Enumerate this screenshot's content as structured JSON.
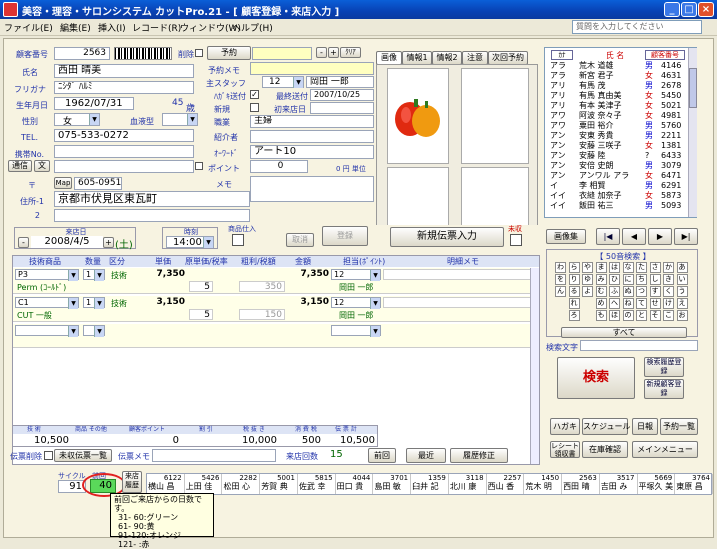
{
  "window": {
    "title": "美容・理容・サロンシステム カットPro.21 - [ 顧客登録・来店入力 ]"
  },
  "menu": [
    "ファイル(E)",
    "編集(E)",
    "挿入(I)",
    "レコード(R)",
    "ウィンドウ(W)",
    "ヘルプ(H)"
  ],
  "help_placeholder": "質問を入力してください",
  "customer": {
    "id_label": "顧客番号",
    "id": "2563",
    "delete_label": "削除",
    "reserve_btn": "予約",
    "clear_btn": "ｸﾘｱ",
    "name_label": "氏名",
    "name": "西田 晴美",
    "furigana_label": "フリガナ",
    "furigana": "ﾆｼﾀﾞ ﾊﾙﾐ",
    "dob_label": "生年月日",
    "dob": "1962/07/31",
    "age": "45",
    "age_unit": "歳",
    "sex_label": "性別",
    "sex": "女",
    "blood_label": "血液型",
    "tel_label": "TEL.",
    "tel": "075-533-0272",
    "mobile_label": "携帯No.",
    "mail_btn": "通信",
    "text_btn": "文",
    "zip_label": "〒",
    "map_btn": "Map",
    "zip": "605-0951",
    "addr1_label": "住所-1",
    "addr1": "京都市伏見区東瓦町",
    "addr2_label": "2",
    "memo_label": "予約メモ",
    "staff_label": "主スタッフ",
    "staff_no": "12",
    "staff_name": "岡田 一郎",
    "dm_label": "ﾊｶﾞｷ送付",
    "last_sent_label": "最終送付",
    "last_sent": "2007/10/25",
    "new_label": "新規",
    "first_staff_label": "初来店日",
    "job_label": "職業",
    "job": "主婦",
    "intro_label": "紹介者",
    "keyword_label": "ｵｰﾜｰﾄﾞ",
    "keyword": "アート10",
    "point_label": "ポイント",
    "point": "0",
    "point_unit": "0 円 単位",
    "memo2_label": "メモ"
  },
  "photo_tabs": [
    "画像",
    "情報1",
    "情報2",
    "注意",
    "次回予約"
  ],
  "clist": {
    "h_kana": "ｶﾅ",
    "h_name": "氏 名",
    "h_num": "顧客番号",
    "rows": [
      [
        "アラ",
        "荒木 道雄",
        "男",
        "4146"
      ],
      [
        "アラ",
        "新宮 君子",
        "女",
        "4631"
      ],
      [
        "アリ",
        "有馬 茂",
        "男",
        "2678"
      ],
      [
        "アリ",
        "有馬 真由美",
        "女",
        "5450"
      ],
      [
        "アリ",
        "有本 美津子",
        "女",
        "5021"
      ],
      [
        "アワ",
        "阿波 奈々子",
        "女",
        "4981"
      ],
      [
        "アワ",
        "粟田 裕介",
        "男",
        "5760"
      ],
      [
        "アン",
        "安東 秀貴",
        "男",
        "2211"
      ],
      [
        "アン",
        "安藤 三咲子",
        "女",
        "1381"
      ],
      [
        "アン",
        "安藤 陸",
        "?",
        "6433"
      ],
      [
        "アン",
        "安倍 史朗",
        "男",
        "3079"
      ],
      [
        "アン",
        "アンワル アラ",
        "女",
        "6471"
      ],
      [
        "イ",
        "李 相賢",
        "男",
        "6291"
      ],
      [
        "イイ",
        "衣縫 加奈子",
        "女",
        "5873"
      ],
      [
        "イイ",
        "飯田 祐三",
        "男",
        "5093"
      ]
    ],
    "image_btn": "画像集"
  },
  "kana_title": "【 50音検索 】",
  "kana_rows": [
    [
      "わ",
      "ら",
      "や",
      "ま",
      "は",
      "な",
      "た",
      "さ",
      "か",
      "あ"
    ],
    [
      "を",
      "り",
      "ゆ",
      "み",
      "ひ",
      "に",
      "ち",
      "し",
      "き",
      "い"
    ],
    [
      "ん",
      "る",
      "よ",
      "む",
      "ふ",
      "ぬ",
      "つ",
      "す",
      "く",
      "う"
    ],
    [
      "",
      "れ",
      "",
      "め",
      "へ",
      "ね",
      "て",
      "せ",
      "け",
      "え"
    ],
    [
      "",
      "ろ",
      "",
      "も",
      "ほ",
      "の",
      "と",
      "そ",
      "こ",
      "お"
    ]
  ],
  "kana_all": "すべて",
  "search": {
    "label": "検索文字",
    "btn": "検索",
    "hist_btn": "検索履歴登録",
    "new_btn": "新規顧客登録"
  },
  "side_btns": [
    "ハガキ",
    "スケジュール",
    "日報",
    "予約一覧",
    "レシート領収書",
    "在庫確認",
    "メインメニュー"
  ],
  "visit": {
    "date_label": "来店日",
    "date": "2008/4/5",
    "weekday": "(土)",
    "time_label": "時刻",
    "time": "14:00",
    "goods_label": "商品仕入",
    "cancel_btn": "取消",
    "register_btn": "登録",
    "new_slip_btn": "新規伝票入力",
    "unpaid_label": "未収"
  },
  "slip": {
    "headers": [
      "技術商品",
      "数量",
      "区分",
      "単価",
      "原単価/税率",
      "粗利/税額",
      "金額",
      "担当(ﾎﾟｲﾝﾄ)",
      "明細メモ"
    ],
    "rows": [
      {
        "code": "P3",
        "qty": "1",
        "kind": "技術",
        "price": "7,350",
        "amount": "7,350",
        "staff": "12",
        "sub": "Perm (ｺｰﾙﾄﾞ)",
        "rate": "5",
        "tax": "350",
        "sname": "岡田 一郎"
      },
      {
        "code": "C1",
        "qty": "1",
        "kind": "技術",
        "price": "3,150",
        "amount": "3,150",
        "staff": "12",
        "sub": "CUT 一般",
        "rate": "5",
        "tax": "150",
        "sname": "岡田 一郎"
      }
    ]
  },
  "totals": {
    "labels": [
      "技 術",
      "商品 その他",
      "顧客ポイント",
      "割 引",
      "税 抜 き",
      "消 費 税",
      "伝 票 計"
    ],
    "tech": "10,500",
    "point": "0",
    "net": "10,000",
    "tax": "500",
    "total": "10,500"
  },
  "footer": {
    "slip_del": "伝票削除",
    "unpaid_list": "未収伝票一覧",
    "memo": "伝票メモ",
    "visits_label": "来店回数",
    "visits": "15",
    "prev": "前回",
    "latest": "最近",
    "history": "履歴修正"
  },
  "cycle": {
    "label1": "サイクル",
    "label2": "前回",
    "v1": "91",
    "v2": "40",
    "hist_btn": "来店履歴"
  },
  "staff_strip": [
    [
      "6122",
      "横山 昌"
    ],
    [
      "5426",
      "上田 佳"
    ],
    [
      "2282",
      "松田 心"
    ],
    [
      "5001",
      "芳賀 典"
    ],
    [
      "5815",
      "佐武 幸"
    ],
    [
      "4044",
      "田口 貴"
    ],
    [
      "3701",
      "島田 敏"
    ],
    [
      "1359",
      "臼井 記"
    ],
    [
      "3118",
      "北川 康"
    ],
    [
      "2257",
      "西山 香"
    ],
    [
      "1450",
      "荒木 明"
    ],
    [
      "2563",
      "西田 晴"
    ],
    [
      "3517",
      "吉田 み"
    ],
    [
      "5669",
      "平塚久 美"
    ],
    [
      "3764",
      "東原 昌"
    ]
  ],
  "tooltip": {
    "title": "前回ご来店からの日数です。",
    "lines": [
      "31- 60:グリーン",
      "61- 90:黄",
      "91-120:オレンジ",
      "121- :赤"
    ]
  }
}
